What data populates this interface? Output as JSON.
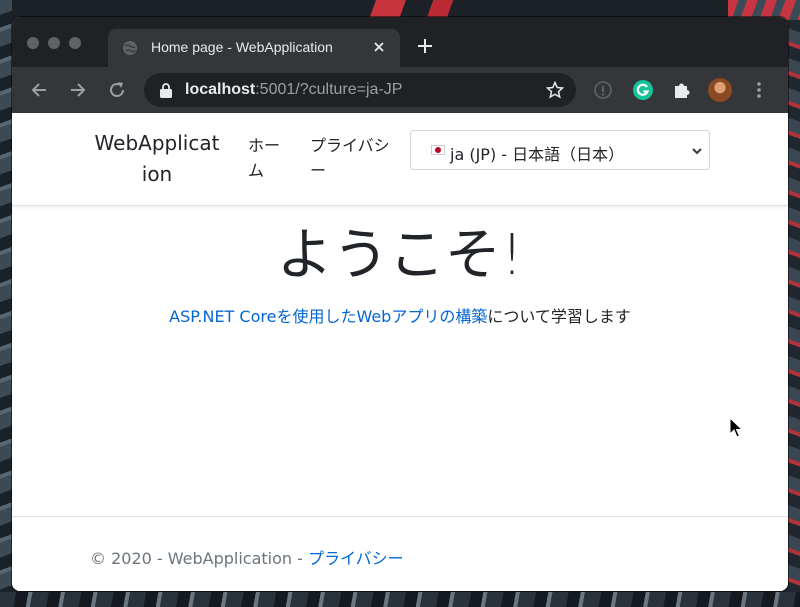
{
  "browser": {
    "tab_title": "Home page - WebApplication",
    "url_host": "localhost",
    "url_rest": ":5001/?culture=ja-JP"
  },
  "site": {
    "brand": "WebApplication",
    "nav": {
      "home": "ホーム",
      "privacy": "プライバシー"
    },
    "culture_select": {
      "selected": "ja (JP) - 日本語（日本）"
    }
  },
  "main": {
    "heading": "ようこそ!",
    "lead_link": "ASP.NET Coreを使用したWebアプリの構築",
    "lead_rest": "について学習します"
  },
  "footer": {
    "copyright": "© 2020 - WebApplication - ",
    "privacy_link": "プライバシー"
  },
  "colors": {
    "link": "#0366d6",
    "chrome_dark": "#202124",
    "chrome_toolbar": "#35363a"
  }
}
